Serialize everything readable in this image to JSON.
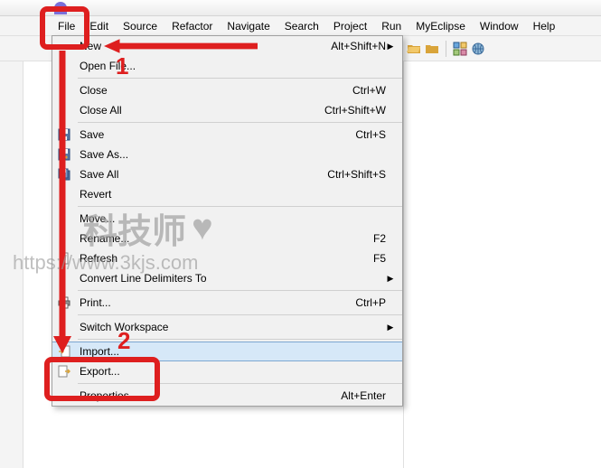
{
  "menubar": {
    "items": [
      {
        "label": "File"
      },
      {
        "label": "Edit"
      },
      {
        "label": "Source"
      },
      {
        "label": "Refactor"
      },
      {
        "label": "Navigate"
      },
      {
        "label": "Search"
      },
      {
        "label": "Project"
      },
      {
        "label": "Run"
      },
      {
        "label": "MyEclipse"
      },
      {
        "label": "Window"
      },
      {
        "label": "Help"
      }
    ]
  },
  "file_menu": {
    "items": [
      {
        "label": "New",
        "shortcut": "Alt+Shift+N",
        "submenu": true
      },
      {
        "label": "Open File..."
      },
      {
        "sep": true
      },
      {
        "label": "Close",
        "shortcut": "Ctrl+W"
      },
      {
        "label": "Close All",
        "shortcut": "Ctrl+Shift+W"
      },
      {
        "sep": true
      },
      {
        "label": "Save",
        "shortcut": "Ctrl+S",
        "icon": "save"
      },
      {
        "label": "Save As...",
        "icon": "saveas"
      },
      {
        "label": "Save All",
        "shortcut": "Ctrl+Shift+S",
        "icon": "saveall"
      },
      {
        "label": "Revert"
      },
      {
        "sep": true
      },
      {
        "label": "Move..."
      },
      {
        "label": "Rename...",
        "shortcut": "F2"
      },
      {
        "label": "Refresh",
        "shortcut": "F5",
        "icon": "refresh"
      },
      {
        "label": "Convert Line Delimiters To",
        "submenu": true
      },
      {
        "sep": true
      },
      {
        "label": "Print...",
        "shortcut": "Ctrl+P",
        "icon": "print"
      },
      {
        "sep": true
      },
      {
        "label": "Switch Workspace",
        "submenu": true
      },
      {
        "sep": true
      },
      {
        "label": "Import...",
        "icon": "import",
        "highlighted": true
      },
      {
        "label": "Export...",
        "icon": "export"
      },
      {
        "sep": true
      },
      {
        "label": "Properties",
        "shortcut": "Alt+Enter"
      }
    ]
  },
  "annotations": {
    "step1": "1",
    "step2": "2"
  },
  "watermark": {
    "text": "科技师",
    "url": "https://www.3kjs.com"
  }
}
